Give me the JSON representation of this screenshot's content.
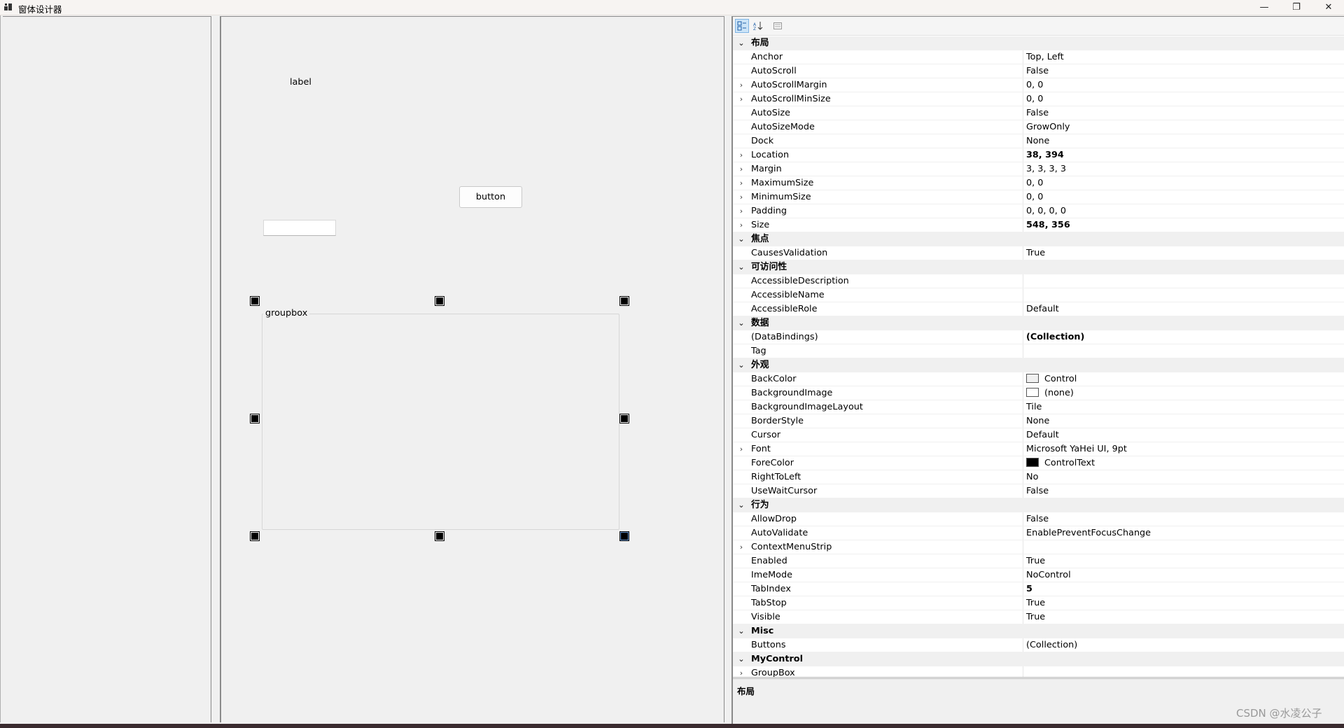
{
  "window": {
    "title": "窗体设计器",
    "minimize_glyph": "—",
    "maximize_glyph": "❐",
    "close_glyph": "✕"
  },
  "canvas": {
    "label_text": "label",
    "button_text": "button",
    "textbox_value": "",
    "groupbox_caption": "groupbox"
  },
  "props": {
    "rows": [
      {
        "type": "cat",
        "name": "布局"
      },
      {
        "name": "Anchor",
        "value": "Top, Left"
      },
      {
        "name": "AutoScroll",
        "value": "False"
      },
      {
        "name": "AutoScrollMargin",
        "value": "0, 0",
        "expandable": true
      },
      {
        "name": "AutoScrollMinSize",
        "value": "0, 0",
        "expandable": true
      },
      {
        "name": "AutoSize",
        "value": "False"
      },
      {
        "name": "AutoSizeMode",
        "value": "GrowOnly"
      },
      {
        "name": "Dock",
        "value": "None"
      },
      {
        "name": "Location",
        "value": "38, 394",
        "expandable": true,
        "bold": true
      },
      {
        "name": "Margin",
        "value": "3, 3, 3, 3",
        "expandable": true
      },
      {
        "name": "MaximumSize",
        "value": "0, 0",
        "expandable": true
      },
      {
        "name": "MinimumSize",
        "value": "0, 0",
        "expandable": true
      },
      {
        "name": "Padding",
        "value": "0, 0, 0, 0",
        "expandable": true
      },
      {
        "name": "Size",
        "value": "548, 356",
        "expandable": true,
        "bold": true
      },
      {
        "type": "cat",
        "name": "焦点"
      },
      {
        "name": "CausesValidation",
        "value": "True"
      },
      {
        "type": "cat",
        "name": "可访问性"
      },
      {
        "name": "AccessibleDescription",
        "value": ""
      },
      {
        "name": "AccessibleName",
        "value": ""
      },
      {
        "name": "AccessibleRole",
        "value": "Default"
      },
      {
        "type": "cat",
        "name": "数据"
      },
      {
        "name": "(DataBindings)",
        "value": "(Collection)",
        "bold": true
      },
      {
        "name": "Tag",
        "value": ""
      },
      {
        "type": "cat",
        "name": "外观"
      },
      {
        "name": "BackColor",
        "value": "Control",
        "swatch": "#f0f0f0"
      },
      {
        "name": "BackgroundImage",
        "value": "(none)",
        "swatch": "#ffffff"
      },
      {
        "name": "BackgroundImageLayout",
        "value": "Tile"
      },
      {
        "name": "BorderStyle",
        "value": "None"
      },
      {
        "name": "Cursor",
        "value": "Default"
      },
      {
        "name": "Font",
        "value": "Microsoft YaHei UI, 9pt",
        "expandable": true
      },
      {
        "name": "ForeColor",
        "value": "ControlText",
        "swatch": "#000000"
      },
      {
        "name": "RightToLeft",
        "value": "No"
      },
      {
        "name": "UseWaitCursor",
        "value": "False"
      },
      {
        "type": "cat",
        "name": "行为"
      },
      {
        "name": "AllowDrop",
        "value": "False"
      },
      {
        "name": "AutoValidate",
        "value": "EnablePreventFocusChange"
      },
      {
        "name": "ContextMenuStrip",
        "value": "",
        "expandable": true
      },
      {
        "name": "Enabled",
        "value": "True"
      },
      {
        "name": "ImeMode",
        "value": "NoControl"
      },
      {
        "name": "TabIndex",
        "value": "5",
        "bold": true
      },
      {
        "name": "TabStop",
        "value": "True"
      },
      {
        "name": "Visible",
        "value": "True"
      },
      {
        "type": "cat",
        "name": "Misc"
      },
      {
        "name": "Buttons",
        "value": "(Collection)"
      },
      {
        "type": "cat",
        "name": "MyControl"
      },
      {
        "name": "GroupBox",
        "value": "",
        "expandable": true
      }
    ],
    "description_title": "布局"
  },
  "watermark": "CSDN @水凌公子",
  "colors": {
    "accent": "#0078d4",
    "category_bg": "#f0f0f0"
  }
}
